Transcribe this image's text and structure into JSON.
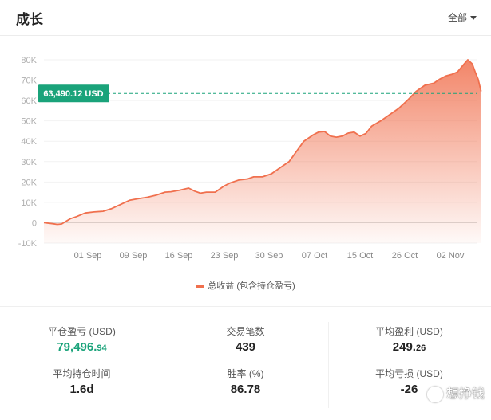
{
  "header": {
    "title": "成长",
    "filter_label": "全部"
  },
  "chart_data": {
    "type": "area",
    "yticks": [
      "80K",
      "70K",
      "60K",
      "50K",
      "40K",
      "30K",
      "20K",
      "10K",
      "0",
      "-10K"
    ],
    "ytick_values": [
      80000,
      70000,
      60000,
      50000,
      40000,
      30000,
      20000,
      10000,
      0,
      -10000
    ],
    "ylim": [
      -10000,
      80000
    ],
    "xticks": [
      "01 Sep",
      "09 Sep",
      "16 Sep",
      "23 Sep",
      "30 Sep",
      "07 Oct",
      "15 Oct",
      "26 Oct",
      "02 Nov"
    ],
    "series": [
      {
        "name": "总收益 (包含持仓盈亏)",
        "color": "#f0704e",
        "points": [
          [
            0,
            0
          ],
          [
            0.03,
            -500
          ],
          [
            0.045,
            -800
          ],
          [
            0.06,
            -600
          ],
          [
            0.09,
            2000
          ],
          [
            0.11,
            3000
          ],
          [
            0.14,
            4800
          ],
          [
            0.17,
            5300
          ],
          [
            0.2,
            5600
          ],
          [
            0.23,
            7000
          ],
          [
            0.26,
            9000
          ],
          [
            0.29,
            11000
          ],
          [
            0.32,
            11800
          ],
          [
            0.35,
            12500
          ],
          [
            0.38,
            13500
          ],
          [
            0.41,
            15000
          ],
          [
            0.43,
            15200
          ],
          [
            0.46,
            16000
          ],
          [
            0.49,
            17000
          ],
          [
            0.51,
            15500
          ],
          [
            0.53,
            14500
          ],
          [
            0.55,
            15000
          ],
          [
            0.58,
            15000
          ],
          [
            0.61,
            18000
          ],
          [
            0.63,
            19500
          ],
          [
            0.66,
            21000
          ],
          [
            0.69,
            21500
          ],
          [
            0.71,
            22500
          ],
          [
            0.74,
            22500
          ],
          [
            0.77,
            24000
          ],
          [
            0.8,
            27000
          ],
          [
            0.83,
            30000
          ],
          [
            0.86,
            36000
          ],
          [
            0.88,
            40000
          ],
          [
            0.91,
            43000
          ],
          [
            0.93,
            44500
          ],
          [
            0.95,
            44800
          ],
          [
            0.97,
            42500
          ],
          [
            0.99,
            42000
          ],
          [
            1.01,
            42500
          ],
          [
            1.03,
            44000
          ],
          [
            1.05,
            44500
          ],
          [
            1.07,
            42500
          ],
          [
            1.09,
            43800
          ],
          [
            1.11,
            47500
          ],
          [
            1.14,
            50000
          ],
          [
            1.17,
            53000
          ],
          [
            1.2,
            56000
          ],
          [
            1.23,
            60000
          ],
          [
            1.26,
            64500
          ],
          [
            1.29,
            67500
          ],
          [
            1.32,
            68500
          ],
          [
            1.34,
            70500
          ],
          [
            1.36,
            72000
          ],
          [
            1.38,
            72800
          ],
          [
            1.4,
            74000
          ],
          [
            1.42,
            77500
          ],
          [
            1.435,
            80000
          ],
          [
            1.45,
            78000
          ],
          [
            1.46,
            74000
          ],
          [
            1.47,
            70500
          ],
          [
            1.48,
            64500
          ]
        ]
      }
    ],
    "annotation": {
      "label": "63,490.12 USD",
      "value": 63490.12,
      "color": "#1aa37a"
    }
  },
  "stats": {
    "pnl": {
      "label": "平仓盈亏 (USD)",
      "value_main": "79,496.",
      "value_dec": "94"
    },
    "trades": {
      "label": "交易笔数",
      "value": "439"
    },
    "avg_profit": {
      "label": "平均盈利 (USD)",
      "value_main": "249.",
      "value_dec": "26"
    },
    "hold_time": {
      "label": "平均持仓时间",
      "value": "1.6d"
    },
    "win_rate": {
      "label": "胜率 (%)",
      "value": "86.78"
    },
    "avg_loss": {
      "label": "平均亏损 (USD)",
      "value": "-26"
    }
  },
  "watermark": {
    "text": "想挣钱"
  },
  "colors": {
    "accent": "#f0704e",
    "green": "#1aa37a"
  }
}
